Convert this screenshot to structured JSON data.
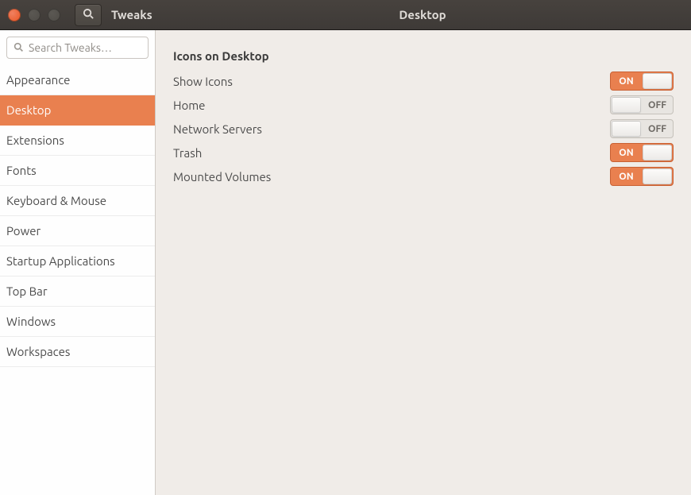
{
  "header": {
    "app_title": "Tweaks",
    "page_title": "Desktop"
  },
  "search": {
    "placeholder": "Search Tweaks…"
  },
  "sidebar": {
    "items": [
      {
        "label": "Appearance",
        "selected": false
      },
      {
        "label": "Desktop",
        "selected": true
      },
      {
        "label": "Extensions",
        "selected": false
      },
      {
        "label": "Fonts",
        "selected": false
      },
      {
        "label": "Keyboard & Mouse",
        "selected": false
      },
      {
        "label": "Power",
        "selected": false
      },
      {
        "label": "Startup Applications",
        "selected": false
      },
      {
        "label": "Top Bar",
        "selected": false
      },
      {
        "label": "Windows",
        "selected": false
      },
      {
        "label": "Workspaces",
        "selected": false
      }
    ]
  },
  "content": {
    "section_title": "Icons on Desktop",
    "rows": [
      {
        "label": "Show Icons",
        "state": "on"
      },
      {
        "label": "Home",
        "state": "off"
      },
      {
        "label": "Network Servers",
        "state": "off"
      },
      {
        "label": "Trash",
        "state": "on"
      },
      {
        "label": "Mounted Volumes",
        "state": "on"
      }
    ]
  },
  "switch_labels": {
    "on": "ON",
    "off": "OFF"
  }
}
